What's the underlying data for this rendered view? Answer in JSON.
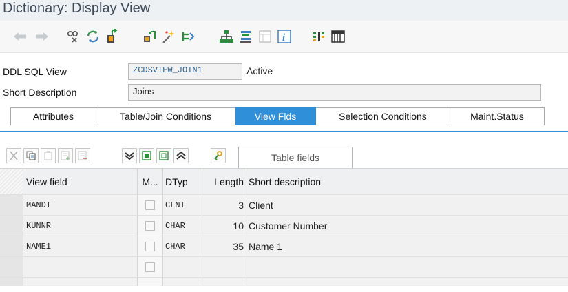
{
  "window": {
    "title": "Dictionary: Display View"
  },
  "toolbar": {
    "icons": [
      "back-arrow-icon",
      "forward-arrow-icon",
      "other-object-icon",
      "display-change-icon",
      "activate-icon",
      "where-used-icon",
      "object-list-icon",
      "display-object-list-icon",
      "hierarchy-icon",
      "navigation-window-icon",
      "documentation-icon",
      "info-icon",
      "columns-icon",
      "table-icon"
    ]
  },
  "header": {
    "ddl_sql_view_label": "DDL SQL View",
    "ddl_sql_view_value": "ZCDSVIEW_JOIN1",
    "status": "Active",
    "short_description_label": "Short Description",
    "short_description_value": "Joins"
  },
  "tabs": [
    {
      "label": "Attributes",
      "active": false
    },
    {
      "label": "Table/Join Conditions",
      "active": false
    },
    {
      "label": "View Flds",
      "active": true
    },
    {
      "label": "Selection Conditions",
      "active": false
    },
    {
      "label": "Maint.Status",
      "active": false
    }
  ],
  "table_toolbar": {
    "table_fields_label": "Table fields"
  },
  "table": {
    "columns": [
      "View field",
      "M...",
      "DTyp",
      "Length",
      "Short description"
    ],
    "rows": [
      {
        "view_field": "MANDT",
        "dtyp": "CLNT",
        "length": "3",
        "short_description": "Client"
      },
      {
        "view_field": "KUNNR",
        "dtyp": "CHAR",
        "length": "10",
        "short_description": "Customer Number"
      },
      {
        "view_field": "NAME1",
        "dtyp": "CHAR",
        "length": "35",
        "short_description": "Name 1"
      },
      {
        "view_field": "",
        "dtyp": "",
        "length": "",
        "short_description": ""
      }
    ]
  },
  "colors": {
    "accent": "#2f8fd8",
    "title_text": "#3d4a57",
    "link_value": "#2a5f8f"
  }
}
